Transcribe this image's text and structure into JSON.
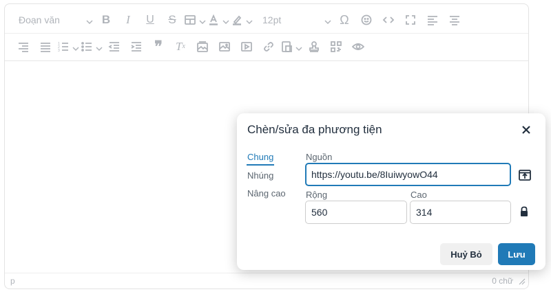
{
  "editor": {
    "toolbar": {
      "block_format": "Đoạn văn",
      "font_size": "12pt",
      "icons": [
        "bold-icon",
        "italic-icon",
        "underline-icon",
        "strikethrough-icon",
        "table-icon",
        "font-color-icon",
        "highlight-icon",
        "special-char-icon",
        "emoji-icon",
        "code-icon",
        "fullscreen-icon",
        "align-left-icon",
        "align-center-icon",
        "align-right-icon",
        "justify-icon",
        "numbered-list-icon",
        "bullet-list-icon",
        "outdent-icon",
        "indent-icon",
        "blockquote-icon",
        "clear-format-icon",
        "image-gallery-icon",
        "image-icon",
        "media-icon",
        "link-icon",
        "template-icon",
        "stamp-icon",
        "qr-icon",
        "preview-icon"
      ],
      "icon_color": "#b0b4ba"
    },
    "status": {
      "path": "p",
      "word_count": "0 chữ"
    }
  },
  "dialog": {
    "title": "Chèn/sửa đa phương tiện",
    "tabs": [
      "Chung",
      "Nhúng",
      "Nâng cao"
    ],
    "active_tab": "Chung",
    "source_label": "Nguồn",
    "source_value": "https://youtu.be/8IuiwyowO44",
    "width_label": "Rộng",
    "width_value": "560",
    "height_label": "Cao",
    "height_value": "314",
    "cancel_label": "Huỷ Bỏ",
    "save_label": "Lưu",
    "accent_color": "#207ab7"
  }
}
